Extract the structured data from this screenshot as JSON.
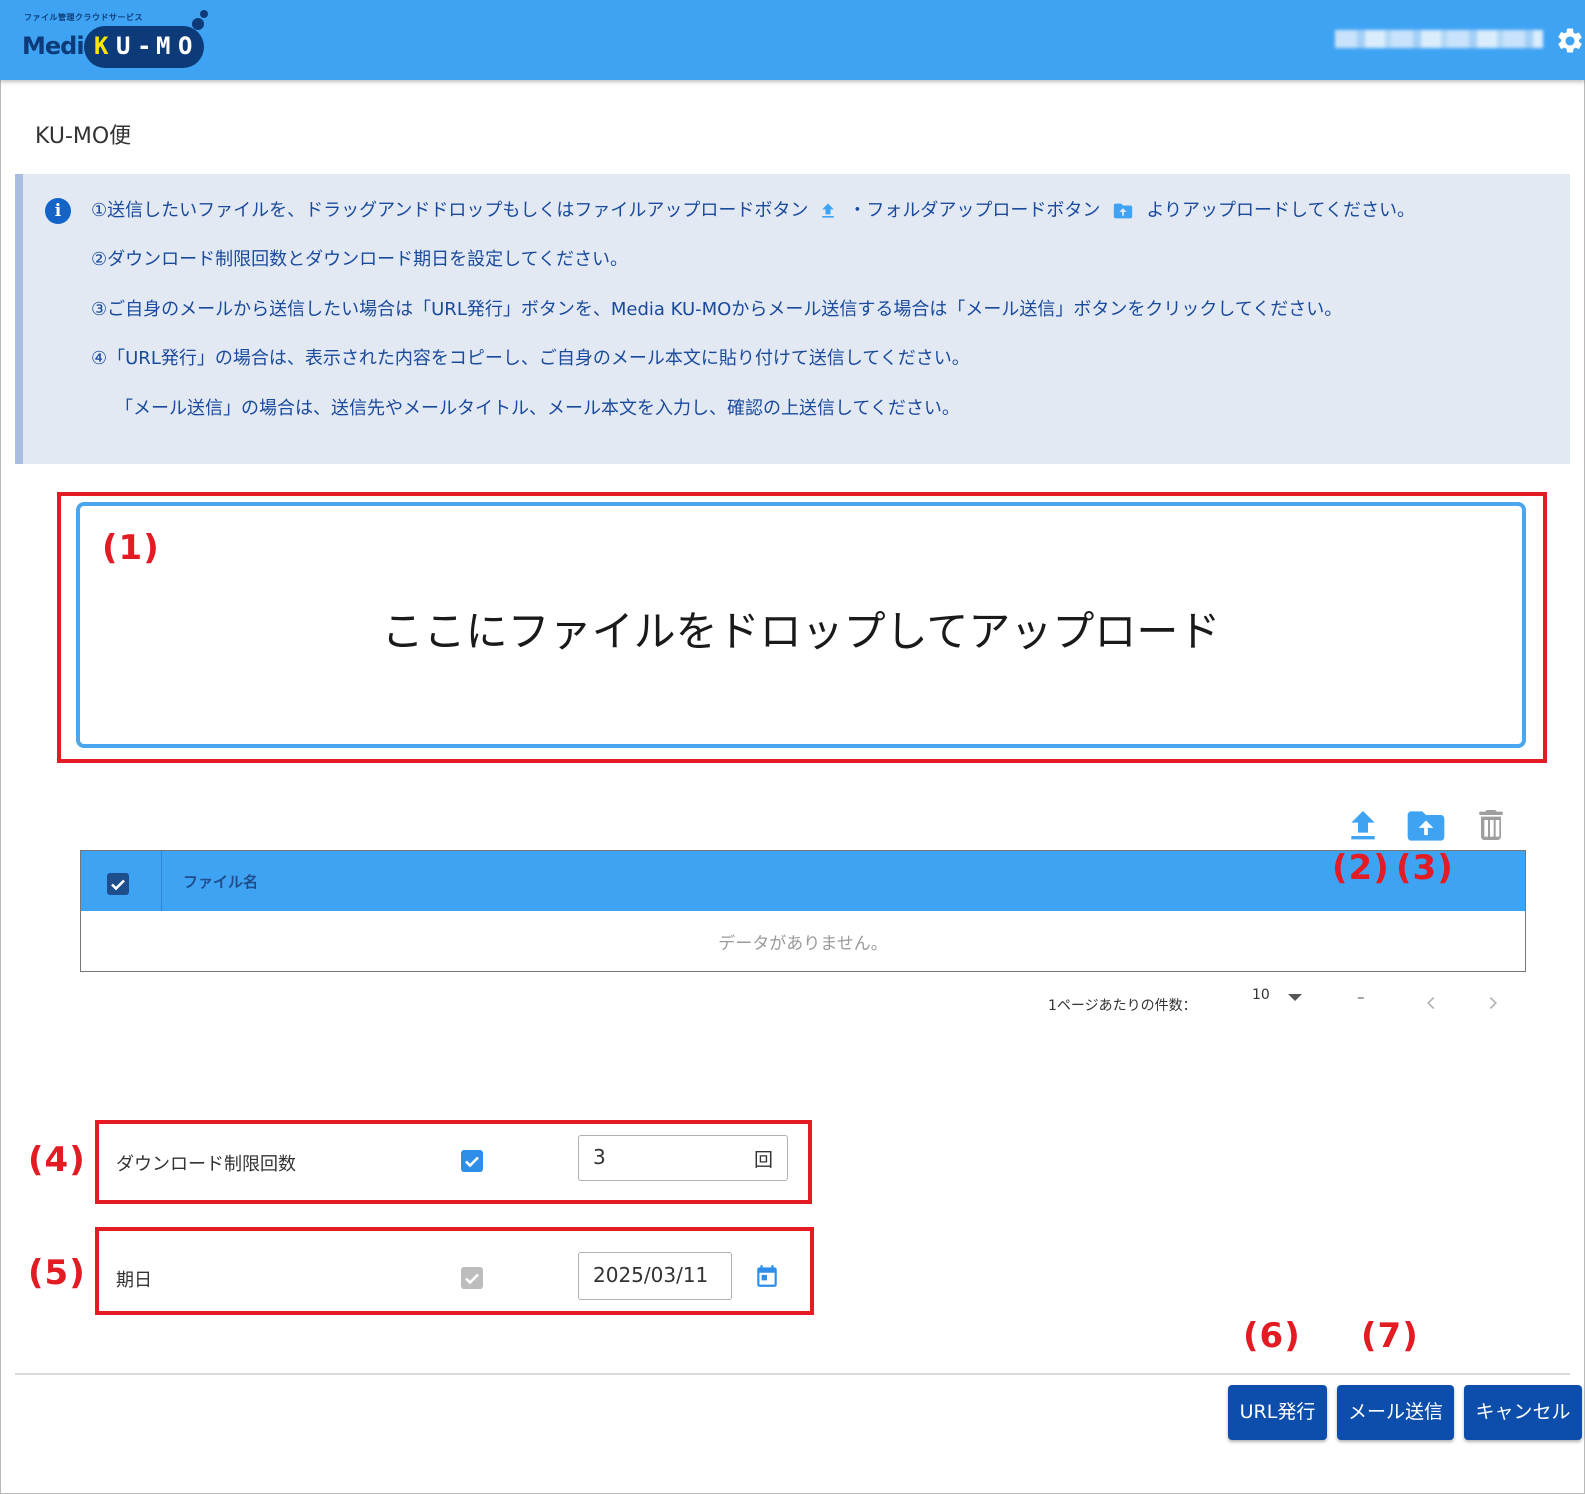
{
  "header": {
    "logo_sub": "ファイル管理クラウドサービス",
    "logo_media": "Media",
    "logo_k": "K",
    "logo_u": "U",
    "logo_dash": "-",
    "logo_m": "M",
    "logo_o": "O",
    "brand_color": "#3fa3f4"
  },
  "page": {
    "title": "KU-MO便"
  },
  "info": {
    "line1_a": "①送信したいファイルを、ドラッグアンドドロップもしくはファイルアップロードボタン",
    "line1_b": "・フォルダアップロードボタン",
    "line1_c": "よりアップロードしてください。",
    "line2": "②ダウンロード制限回数とダウンロード期日を設定してください。",
    "line3": "③ご自身のメールから送信したい場合は「URL発行」ボタンを、Media KU-MOからメール送信する場合は「メール送信」ボタンをクリックしてください。",
    "line4": "④「URL発行」の場合は、表示された内容をコピーし、ご自身のメール本文に貼り付けて送信してください。",
    "line5": "「メール送信」の場合は、送信先やメールタイトル、メール本文を入力し、確認の上送信してください。"
  },
  "dropzone": {
    "text": "ここにファイルをドロップしてアップロード"
  },
  "annotations": {
    "a1": "(1)",
    "a2": "(2)",
    "a3": "(3)",
    "a4": "(4)",
    "a5": "(5)",
    "a6": "(6)",
    "a7": "(7)",
    "color": "#e31b23"
  },
  "table": {
    "header_select_all": true,
    "column_filename": "ファイル名",
    "empty_message": "データがありません。"
  },
  "pager": {
    "per_page_label": "1ページあたりの件数：",
    "per_page_value": "10",
    "range": "–"
  },
  "settings": {
    "download_limit_label": "ダウンロード制限回数",
    "download_limit_enabled": true,
    "download_limit_value": "3",
    "download_limit_unit": "回",
    "due_date_label": "期日",
    "due_date_enabled": true,
    "due_date_value": "2025/03/11"
  },
  "buttons": {
    "issue_url": "URL発行",
    "send_mail": "メール送信",
    "cancel": "キャンセル",
    "color": "#0d4eac"
  }
}
